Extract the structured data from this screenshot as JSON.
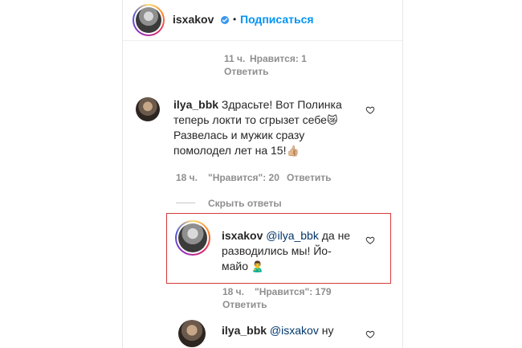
{
  "header": {
    "username": "isxakov",
    "separator": "•",
    "follow_label": "Подписаться"
  },
  "comments": [
    {
      "time": "11 ч.",
      "likes": "Нравится: 1",
      "reply": "Ответить"
    },
    {
      "username": "ilya_bbk",
      "line1": "Здрасьте! Вот Полинка",
      "line2": "теперь локти то сгрызет себе",
      "line3": "Развелась и мужик сразу",
      "line4": "помолодел лет на 15!",
      "time": "18 ч.",
      "likes": "\"Нравится\": 20",
      "reply": "Ответить"
    },
    {
      "hide_replies": "Скрыть ответы"
    },
    {
      "username": "isxakov",
      "mention": "@ilya_bbk",
      "line1_rest": " да не",
      "line2": "разводились мы! Йо-",
      "line3": "майо",
      "time": "18 ч.",
      "likes": "\"Нравится\": 179",
      "reply": "Ответить"
    },
    {
      "username": "ilya_bbk",
      "mention": "@isxakov",
      "line1_rest": " ну"
    }
  ],
  "icons": {
    "verified": "verified-badge-icon",
    "heart": "heart-outline-icon",
    "emoji1": "cat-face-emoji",
    "emoji2": "thumbs-up-emoji",
    "emoji3": "person-emoji"
  },
  "colors": {
    "accent": "#0095f6",
    "text": "#262626",
    "muted": "#8e8e8e",
    "highlight": "#d83a3a"
  }
}
